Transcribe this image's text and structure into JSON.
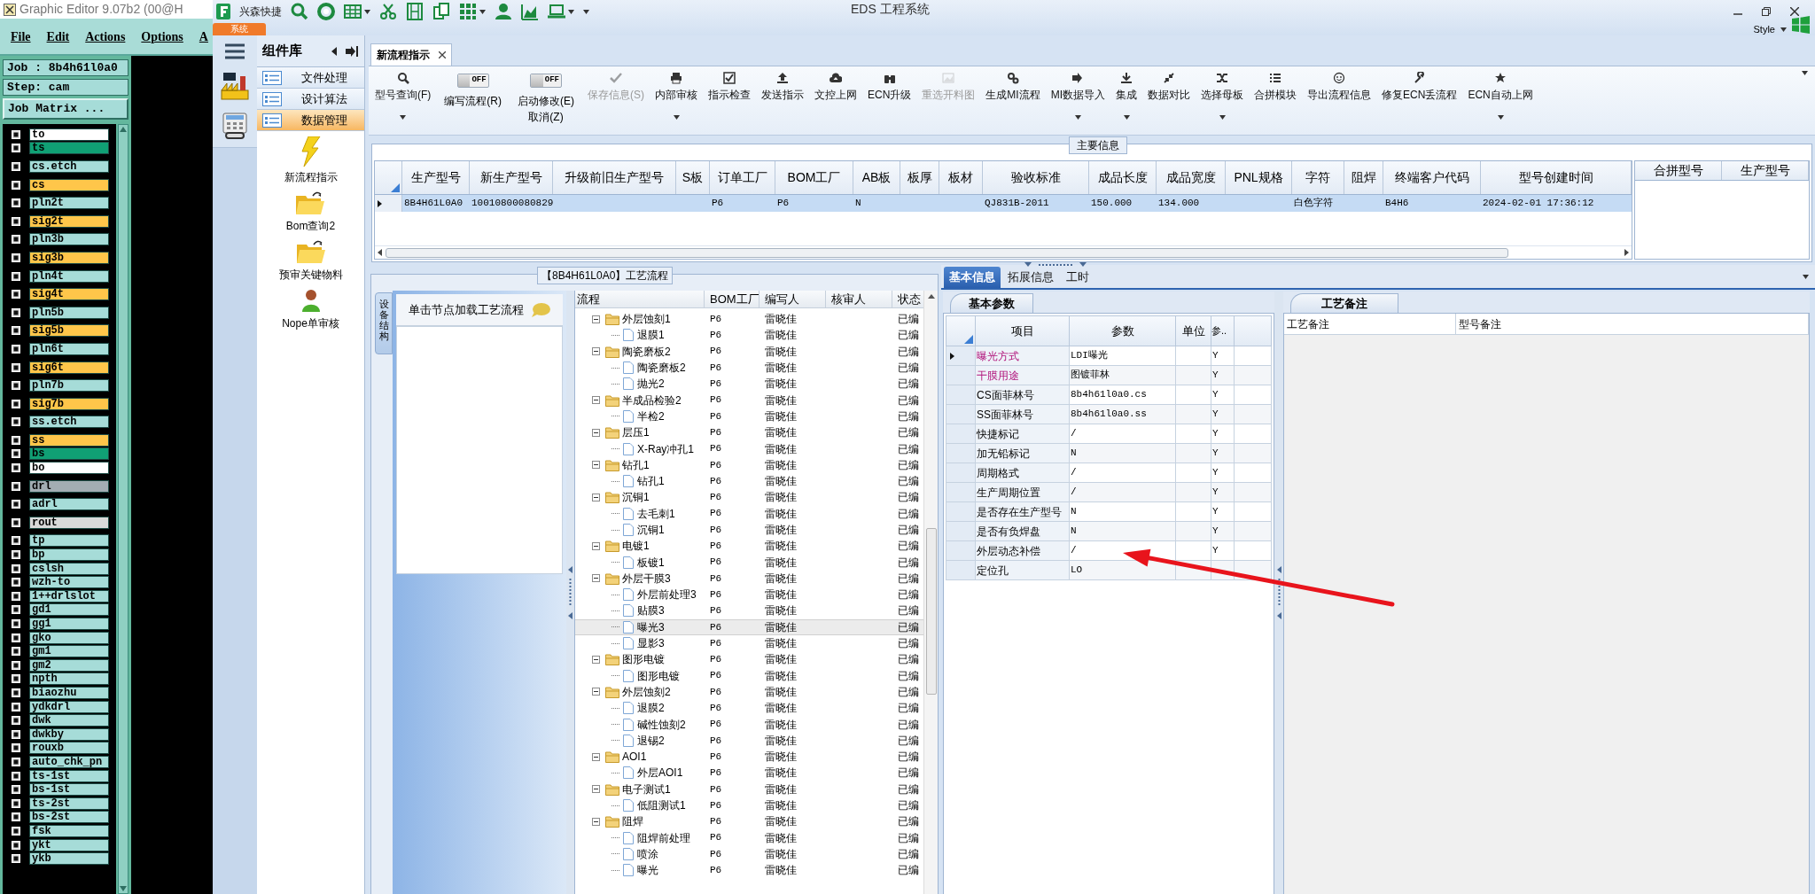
{
  "editor": {
    "title": "Graphic Editor 9.07b2 (00@H",
    "menu": [
      "File",
      "Edit",
      "Actions",
      "Options",
      "A"
    ],
    "job": "Job : 8b4h61l0a0",
    "step": "Step: cam",
    "matrix_button": "Job Matrix ...",
    "layer_groups": [
      [
        {
          "name": "to",
          "color": "#ffffff",
          "checked": false
        },
        {
          "name": "ts",
          "color": "#10a074",
          "checked": false
        }
      ],
      [
        {
          "name": "cs.etch",
          "color": "#a6dcd8",
          "checked": false
        }
      ],
      [
        {
          "name": "cs",
          "color": "#ffc64a",
          "checked": false
        }
      ],
      [
        {
          "name": "pln2t",
          "color": "#a6dcd8",
          "checked": false
        }
      ],
      [
        {
          "name": "sig2t",
          "color": "#ffc64a",
          "checked": false
        }
      ],
      [
        {
          "name": "pln3b",
          "color": "#a6dcd8",
          "checked": false
        }
      ],
      [
        {
          "name": "sig3b",
          "color": "#ffc64a",
          "checked": false
        }
      ],
      [
        {
          "name": "pln4t",
          "color": "#a6dcd8",
          "checked": false
        }
      ],
      [
        {
          "name": "sig4t",
          "color": "#ffc64a",
          "checked": false
        }
      ],
      [
        {
          "name": "pln5b",
          "color": "#a6dcd8",
          "checked": false
        }
      ],
      [
        {
          "name": "sig5b",
          "color": "#ffc64a",
          "checked": false
        }
      ],
      [
        {
          "name": "pln6t",
          "color": "#a6dcd8",
          "checked": false
        }
      ],
      [
        {
          "name": "sig6t",
          "color": "#ffc64a",
          "checked": false
        }
      ],
      [
        {
          "name": "pln7b",
          "color": "#a6dcd8",
          "checked": false
        }
      ],
      [
        {
          "name": "sig7b",
          "color": "#ffc64a",
          "checked": false
        }
      ],
      [
        {
          "name": "ss.etch",
          "color": "#a6dcd8",
          "checked": false
        }
      ],
      [
        {
          "name": "ss",
          "color": "#ffc64a",
          "checked": false
        },
        {
          "name": "bs",
          "color": "#10a074",
          "checked": false
        },
        {
          "name": "bo",
          "color": "#ffffff",
          "checked": false
        }
      ],
      [
        {
          "name": "drl",
          "color": "#a3adb3",
          "checked": false
        }
      ],
      [
        {
          "name": "adrl",
          "color": "#a6dcd8",
          "checked": false
        }
      ],
      [
        {
          "name": "rout",
          "color": "#d9d9d9",
          "checked": false
        }
      ],
      [
        {
          "name": "tp",
          "color": "#a6dcd8",
          "checked": false
        },
        {
          "name": "bp",
          "color": "#a6dcd8",
          "checked": false
        },
        {
          "name": "cslsh",
          "color": "#a6dcd8",
          "checked": false
        },
        {
          "name": "wzh-to",
          "color": "#a6dcd8",
          "checked": false
        },
        {
          "name": "1++drlslot",
          "color": "#a6dcd8",
          "checked": false
        },
        {
          "name": "gd1",
          "color": "#a6dcd8",
          "checked": false
        },
        {
          "name": "gg1",
          "color": "#a6dcd8",
          "checked": false
        },
        {
          "name": "gko",
          "color": "#a6dcd8",
          "checked": false
        },
        {
          "name": "gm1",
          "color": "#a6dcd8",
          "checked": false
        },
        {
          "name": "gm2",
          "color": "#a6dcd8",
          "checked": false
        },
        {
          "name": "npth",
          "color": "#a6dcd8",
          "checked": false
        },
        {
          "name": "biaozhu",
          "color": "#a6dcd8",
          "checked": false
        },
        {
          "name": "ydkdrl",
          "color": "#a6dcd8",
          "checked": false
        },
        {
          "name": "dwk",
          "color": "#a6dcd8",
          "checked": false
        },
        {
          "name": "dwkby",
          "color": "#a6dcd8",
          "checked": false
        },
        {
          "name": "rouxb",
          "color": "#a6dcd8",
          "checked": false
        },
        {
          "name": "auto_chk_pn",
          "color": "#a6dcd8",
          "checked": false
        },
        {
          "name": "ts-1st",
          "color": "#a6dcd8",
          "checked": false
        },
        {
          "name": "bs-1st",
          "color": "#a6dcd8",
          "checked": false
        },
        {
          "name": "ts-2st",
          "color": "#a6dcd8",
          "checked": false
        },
        {
          "name": "bs-2st",
          "color": "#a6dcd8",
          "checked": false
        },
        {
          "name": "fsk",
          "color": "#a6dcd8",
          "checked": false
        },
        {
          "name": "ykt",
          "color": "#a6dcd8",
          "checked": false
        },
        {
          "name": "ykb",
          "color": "#a6dcd8",
          "checked": false
        }
      ]
    ]
  },
  "app": {
    "title": "EDS 工程系统",
    "quick_label": "兴森快捷",
    "system_tab": "系统",
    "style_menu": "Style"
  },
  "component_library": {
    "title": "组件库",
    "categories": [
      {
        "label": "文件处理",
        "selected": false
      },
      {
        "label": "设计算法",
        "selected": false
      },
      {
        "label": "数据管理",
        "selected": true
      }
    ],
    "items": [
      "新流程指示",
      "Bom查询2",
      "预审关键物料",
      "Nope单审核"
    ]
  },
  "doc_tabs": [
    {
      "label": "新流程指示",
      "selected": true
    }
  ],
  "ribbon": [
    {
      "kind": "button",
      "label": "型号查询(F)",
      "menu": true,
      "disabled": false
    },
    {
      "kind": "toggle",
      "label": "编写流程(R)",
      "state_label": "OFF",
      "on": false
    },
    {
      "kind": "toggle",
      "label": "启动修改(E)",
      "sublabel": "取消(Z)",
      "state_label": "OFF",
      "on": false
    },
    {
      "kind": "button",
      "label": "保存信息(S)",
      "menu": false,
      "disabled": true
    },
    {
      "kind": "button",
      "label": "内部审核",
      "menu": true,
      "disabled": false
    },
    {
      "kind": "button",
      "label": "指示检查",
      "menu": false,
      "disabled": false
    },
    {
      "kind": "button",
      "label": "发送指示",
      "menu": false,
      "disabled": false
    },
    {
      "kind": "button",
      "label": "文控上网",
      "menu": false,
      "disabled": false
    },
    {
      "kind": "button",
      "label": "ECN升级",
      "menu": false,
      "disabled": false
    },
    {
      "kind": "button",
      "label": "重选开料图",
      "menu": false,
      "disabled": true
    },
    {
      "kind": "button",
      "label": "生成MI流程",
      "menu": false,
      "disabled": false
    },
    {
      "kind": "button",
      "label": "MI数据导入",
      "menu": true,
      "disabled": false
    },
    {
      "kind": "button",
      "label": "集成",
      "menu": true,
      "disabled": false
    },
    {
      "kind": "button",
      "label": "数据对比",
      "menu": false,
      "disabled": false
    },
    {
      "kind": "button",
      "label": "选择母板",
      "menu": true,
      "disabled": false
    },
    {
      "kind": "button",
      "label": "合拼模块",
      "menu": false,
      "disabled": false
    },
    {
      "kind": "button",
      "label": "导出流程信息",
      "menu": false,
      "disabled": false
    },
    {
      "kind": "button",
      "label": "修复ECN丢流程",
      "menu": false,
      "disabled": false
    },
    {
      "kind": "button",
      "label": "ECN自动上网",
      "menu": true,
      "disabled": false
    }
  ],
  "main_info": {
    "title": "主要信息",
    "columns": [
      "生产型号",
      "新生产型号",
      "升级前旧生产型号",
      "S板",
      "订单工厂",
      "BOM工厂",
      "AB板",
      "板厚",
      "板材",
      "验收标准",
      "成品长度",
      "成品宽度",
      "PNL规格",
      "字符",
      "阻焊",
      "终端客户代码",
      "型号创建时间"
    ],
    "rows": [
      {
        "selected": true,
        "cells": [
          "8B4H61L0A0",
          "10010800080829",
          "",
          "",
          "P6",
          "P6",
          "N",
          "",
          "",
          "QJ831B-2011",
          "150.000",
          "134.000",
          "",
          "白色字符",
          "",
          "B4H6",
          "2024-02-01 17:36:12"
        ]
      }
    ],
    "side_columns": [
      "合拼型号",
      "生产型号"
    ]
  },
  "process": {
    "title": "【8B4H61L0A0】工艺流程",
    "side_tab": "设备结构",
    "hint": "单击节点加载工艺流程",
    "columns": [
      "流程",
      "BOM工厂",
      "编写人",
      "核审人",
      "状态"
    ],
    "tree": [
      {
        "name": "外层蚀刻1",
        "bom": "P6",
        "writer": "雷晓佳",
        "status": "已编",
        "expanded": true,
        "selected": false,
        "children": [
          {
            "name": "退膜1",
            "bom": "P6",
            "writer": "雷晓佳",
            "status": "已编",
            "selected": false
          }
        ]
      },
      {
        "name": "陶瓷磨板2",
        "bom": "P6",
        "writer": "雷晓佳",
        "status": "已编",
        "expanded": true,
        "selected": false,
        "children": [
          {
            "name": "陶瓷磨板2",
            "bom": "P6",
            "writer": "雷晓佳",
            "status": "已编",
            "selected": false
          },
          {
            "name": "抛光2",
            "bom": "P6",
            "writer": "雷晓佳",
            "status": "已编",
            "selected": false
          }
        ]
      },
      {
        "name": "半成品检验2",
        "bom": "P6",
        "writer": "雷晓佳",
        "status": "已编",
        "expanded": true,
        "selected": false,
        "children": [
          {
            "name": "半检2",
            "bom": "P6",
            "writer": "雷晓佳",
            "status": "已编",
            "selected": false
          }
        ]
      },
      {
        "name": "层压1",
        "bom": "P6",
        "writer": "雷晓佳",
        "status": "已编",
        "expanded": true,
        "selected": false,
        "children": [
          {
            "name": "X-Ray冲孔1",
            "bom": "P6",
            "writer": "雷晓佳",
            "status": "已编",
            "selected": false
          }
        ]
      },
      {
        "name": "钻孔1",
        "bom": "P6",
        "writer": "雷晓佳",
        "status": "已编",
        "expanded": true,
        "selected": false,
        "children": [
          {
            "name": "钻孔1",
            "bom": "P6",
            "writer": "雷晓佳",
            "status": "已编",
            "selected": false
          }
        ]
      },
      {
        "name": "沉铜1",
        "bom": "P6",
        "writer": "雷晓佳",
        "status": "已编",
        "expanded": true,
        "selected": false,
        "children": [
          {
            "name": "去毛刺1",
            "bom": "P6",
            "writer": "雷晓佳",
            "status": "已编",
            "selected": false
          },
          {
            "name": "沉铜1",
            "bom": "P6",
            "writer": "雷晓佳",
            "status": "已编",
            "selected": false
          }
        ]
      },
      {
        "name": "电镀1",
        "bom": "P6",
        "writer": "雷晓佳",
        "status": "已编",
        "expanded": true,
        "selected": false,
        "children": [
          {
            "name": "板镀1",
            "bom": "P6",
            "writer": "雷晓佳",
            "status": "已编",
            "selected": false
          }
        ]
      },
      {
        "name": "外层干膜3",
        "bom": "P6",
        "writer": "雷晓佳",
        "status": "已编",
        "expanded": true,
        "selected": false,
        "children": [
          {
            "name": "外层前处理3",
            "bom": "P6",
            "writer": "雷晓佳",
            "status": "已编",
            "selected": false
          },
          {
            "name": "贴膜3",
            "bom": "P6",
            "writer": "雷晓佳",
            "status": "已编",
            "selected": false
          },
          {
            "name": "曝光3",
            "bom": "P6",
            "writer": "雷晓佳",
            "status": "已编",
            "selected": true
          },
          {
            "name": "显影3",
            "bom": "P6",
            "writer": "雷晓佳",
            "status": "已编",
            "selected": false
          }
        ]
      },
      {
        "name": "图形电镀",
        "bom": "P6",
        "writer": "雷晓佳",
        "status": "已编",
        "expanded": true,
        "selected": false,
        "children": [
          {
            "name": "图形电镀",
            "bom": "P6",
            "writer": "雷晓佳",
            "status": "已编",
            "selected": false
          }
        ]
      },
      {
        "name": "外层蚀刻2",
        "bom": "P6",
        "writer": "雷晓佳",
        "status": "已编",
        "expanded": true,
        "selected": false,
        "children": [
          {
            "name": "退膜2",
            "bom": "P6",
            "writer": "雷晓佳",
            "status": "已编",
            "selected": false
          },
          {
            "name": "碱性蚀刻2",
            "bom": "P6",
            "writer": "雷晓佳",
            "status": "已编",
            "selected": false
          },
          {
            "name": "退锡2",
            "bom": "P6",
            "writer": "雷晓佳",
            "status": "已编",
            "selected": false
          }
        ]
      },
      {
        "name": "AOI1",
        "bom": "P6",
        "writer": "雷晓佳",
        "status": "已编",
        "expanded": true,
        "selected": false,
        "children": [
          {
            "name": "外层AOI1",
            "bom": "P6",
            "writer": "雷晓佳",
            "status": "已编",
            "selected": false
          }
        ]
      },
      {
        "name": "电子测试1",
        "bom": "P6",
        "writer": "雷晓佳",
        "status": "已编",
        "expanded": true,
        "selected": false,
        "children": [
          {
            "name": "低阻测试1",
            "bom": "P6",
            "writer": "雷晓佳",
            "status": "已编",
            "selected": false
          }
        ]
      },
      {
        "name": "阻焊",
        "bom": "P6",
        "writer": "雷晓佳",
        "status": "已编",
        "expanded": true,
        "selected": false,
        "children": [
          {
            "name": "阻焊前处理",
            "bom": "P6",
            "writer": "雷晓佳",
            "status": "已编",
            "selected": false
          },
          {
            "name": "喷涂",
            "bom": "P6",
            "writer": "雷晓佳",
            "status": "已编",
            "selected": false
          },
          {
            "name": "曝光",
            "bom": "P6",
            "writer": "雷晓佳",
            "status": "已编",
            "selected": false
          }
        ]
      }
    ]
  },
  "details": {
    "tabs": [
      {
        "label": "基本信息",
        "selected": true
      },
      {
        "label": "拓展信息",
        "selected": false
      },
      {
        "label": "工时",
        "selected": false
      }
    ],
    "section_tab": "基本参数",
    "columns": [
      "项目",
      "参数",
      "单位",
      "参.."
    ],
    "rows": [
      {
        "item": "曝光方式",
        "value": "LDI曝光",
        "flag": "Y",
        "highlighted": true,
        "selected": true
      },
      {
        "item": "干膜用途",
        "value": "图镀菲林",
        "flag": "Y",
        "highlighted": true,
        "selected": false
      },
      {
        "item": "CS面菲林号",
        "value": "8b4h61l0a0.cs",
        "flag": "Y",
        "highlighted": false,
        "selected": false
      },
      {
        "item": "SS面菲林号",
        "value": "8b4h61l0a0.ss",
        "flag": "Y",
        "highlighted": false,
        "selected": false
      },
      {
        "item": "快捷标记",
        "value": "/",
        "flag": "Y",
        "highlighted": false,
        "selected": false
      },
      {
        "item": "加无铅标记",
        "value": "N",
        "flag": "Y",
        "highlighted": false,
        "selected": false
      },
      {
        "item": "周期格式",
        "value": "/",
        "flag": "Y",
        "highlighted": false,
        "selected": false
      },
      {
        "item": "生产周期位置",
        "value": "/",
        "flag": "Y",
        "highlighted": false,
        "selected": false
      },
      {
        "item": "是否存在生产型号",
        "value": "N",
        "flag": "Y",
        "highlighted": false,
        "selected": false
      },
      {
        "item": "是否有负焊盘",
        "value": "N",
        "flag": "Y",
        "highlighted": false,
        "selected": false
      },
      {
        "item": "外层动态补偿",
        "value": "/",
        "flag": "Y",
        "highlighted": false,
        "selected": false
      },
      {
        "item": "定位孔",
        "value": "LO",
        "highlighted": false,
        "selected": false
      }
    ]
  },
  "notes": {
    "tab": "工艺备注",
    "columns": [
      "工艺备注",
      "型号备注"
    ]
  }
}
